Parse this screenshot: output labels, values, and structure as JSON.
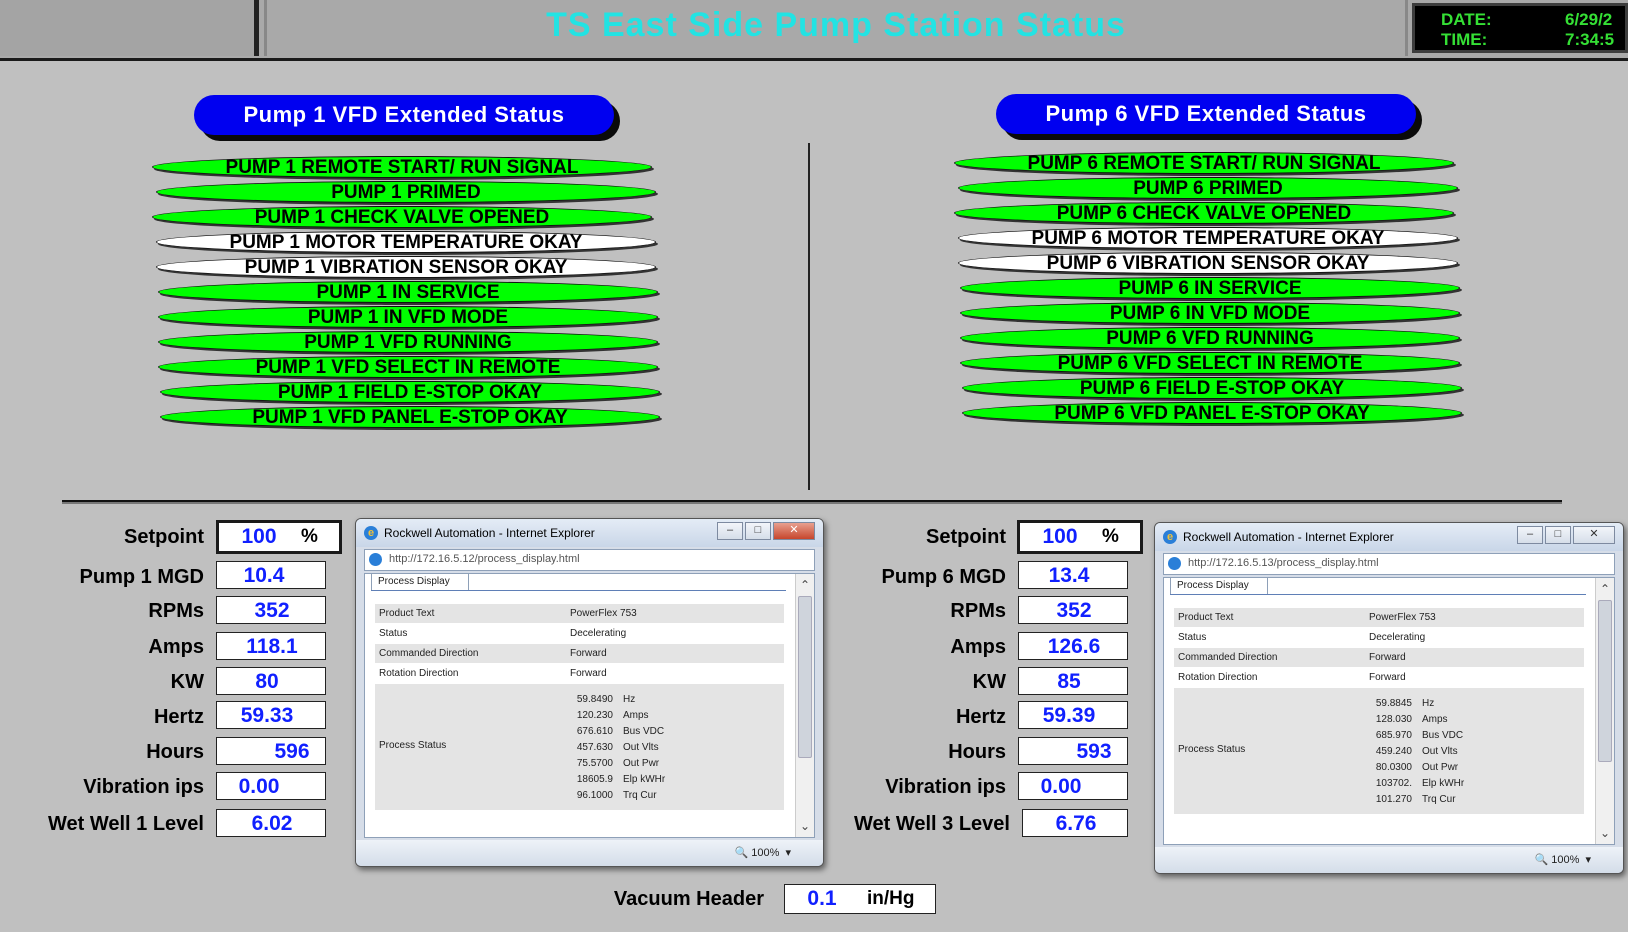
{
  "header": {
    "title": "TS East Side Pump Station Status",
    "date_label": "DATE:",
    "date_value": "6/29/2",
    "time_label": "TIME:",
    "time_value": "7:34:5"
  },
  "pump1": {
    "title": "Pump 1 VFD Extended Status",
    "statuses": [
      {
        "label": "PUMP 1 REMOTE START/ RUN SIGNAL",
        "color": "#00ff00"
      },
      {
        "label": "PUMP 1 PRIMED",
        "color": "#00ff00"
      },
      {
        "label": "PUMP 1 CHECK VALVE OPENED",
        "color": "#00ff00"
      },
      {
        "label": "PUMP 1 MOTOR TEMPERATURE OKAY",
        "color": "#ffffff"
      },
      {
        "label": "PUMP 1 VIBRATION SENSOR OKAY",
        "color": "#ffffff"
      },
      {
        "label": "PUMP 1 IN SERVICE",
        "color": "#00ff00"
      },
      {
        "label": "PUMP 1 IN VFD MODE",
        "color": "#00ff00"
      },
      {
        "label": "PUMP 1 VFD RUNNING",
        "color": "#00ff00"
      },
      {
        "label": "PUMP 1 VFD SELECT IN REMOTE",
        "color": "#00ff00"
      },
      {
        "label": "PUMP 1 FIELD E-STOP OKAY",
        "color": "#00ff00"
      },
      {
        "label": "PUMP 1 VFD PANEL E-STOP OKAY",
        "color": "#00ff00"
      }
    ],
    "fields": {
      "setpoint_label": "Setpoint",
      "setpoint": "100",
      "setpoint_unit": "%",
      "mgd_label": "Pump 1 MGD",
      "mgd": "10.4",
      "rpm_label": "RPMs",
      "rpm": "352",
      "amps_label": "Amps",
      "amps": "118.1",
      "kw_label": "KW",
      "kw": "80",
      "hertz_label": "Hertz",
      "hertz": "59.33",
      "hours_label": "Hours",
      "hours": "596",
      "vib_label": "Vibration ips",
      "vib": "0.00",
      "ww_label": "Wet Well 1 Level",
      "ww": "6.02"
    },
    "browser": {
      "title": "Rockwell Automation - Internet Explorer",
      "url": "http://172.16.5.12/process_display.html",
      "tab": "Process Display",
      "product_text_label": "Product Text",
      "product_text": "PowerFlex 753",
      "status_label": "Status",
      "status": "Decelerating",
      "cmd_dir_label": "Commanded Direction",
      "cmd_dir": "Forward",
      "rot_dir_label": "Rotation Direction",
      "rot_dir": "Forward",
      "process_status_label": "Process Status",
      "process": [
        {
          "value": "59.8490",
          "unit": "Hz"
        },
        {
          "value": "120.230",
          "unit": "Amps"
        },
        {
          "value": "676.610",
          "unit": "Bus VDC"
        },
        {
          "value": "457.630",
          "unit": "Out Vlts"
        },
        {
          "value": "75.5700",
          "unit": "Out Pwr"
        },
        {
          "value": "18605.9",
          "unit": "Elp kWHr"
        },
        {
          "value": "96.1000",
          "unit": "Trq Cur"
        }
      ],
      "zoom": "100%"
    }
  },
  "pump6": {
    "title": "Pump 6 VFD Extended Status",
    "statuses": [
      {
        "label": "PUMP 6 REMOTE START/ RUN SIGNAL",
        "color": "#00ff00"
      },
      {
        "label": "PUMP 6 PRIMED",
        "color": "#00ff00"
      },
      {
        "label": "PUMP 6 CHECK VALVE OPENED",
        "color": "#00ff00"
      },
      {
        "label": "PUMP 6 MOTOR TEMPERATURE OKAY",
        "color": "#ffffff"
      },
      {
        "label": "PUMP 6 VIBRATION SENSOR OKAY",
        "color": "#ffffff"
      },
      {
        "label": "PUMP 6 IN SERVICE",
        "color": "#00ff00"
      },
      {
        "label": "PUMP 6 IN VFD MODE",
        "color": "#00ff00"
      },
      {
        "label": "PUMP 6 VFD RUNNING",
        "color": "#00ff00"
      },
      {
        "label": "PUMP 6 VFD SELECT IN REMOTE",
        "color": "#00ff00"
      },
      {
        "label": "PUMP 6 FIELD E-STOP OKAY",
        "color": "#00ff00"
      },
      {
        "label": "PUMP 6 VFD PANEL E-STOP OKAY",
        "color": "#00ff00"
      }
    ],
    "fields": {
      "setpoint_label": "Setpoint",
      "setpoint": "100",
      "setpoint_unit": "%",
      "mgd_label": "Pump 6 MGD",
      "mgd": "13.4",
      "rpm_label": "RPMs",
      "rpm": "352",
      "amps_label": "Amps",
      "amps": "126.6",
      "kw_label": "KW",
      "kw": "85",
      "hertz_label": "Hertz",
      "hertz": "59.39",
      "hours_label": "Hours",
      "hours": "593",
      "vib_label": "Vibration ips",
      "vib": "0.00",
      "ww_label": "Wet Well 3 Level",
      "ww": "6.76"
    },
    "browser": {
      "title": "Rockwell Automation - Internet Explorer",
      "url": "http://172.16.5.13/process_display.html",
      "tab": "Process Display",
      "product_text_label": "Product Text",
      "product_text": "PowerFlex 753",
      "status_label": "Status",
      "status": "Decelerating",
      "cmd_dir_label": "Commanded Direction",
      "cmd_dir": "Forward",
      "rot_dir_label": "Rotation Direction",
      "rot_dir": "Forward",
      "process_status_label": "Process Status",
      "process": [
        {
          "value": "59.8845",
          "unit": "Hz"
        },
        {
          "value": "128.030",
          "unit": "Amps"
        },
        {
          "value": "685.970",
          "unit": "Bus VDC"
        },
        {
          "value": "459.240",
          "unit": "Out Vlts"
        },
        {
          "value": "80.0300",
          "unit": "Out Pwr"
        },
        {
          "value": "103702.",
          "unit": "Elp kWHr"
        },
        {
          "value": "101.270",
          "unit": "Trq Cur"
        }
      ],
      "zoom": "100%"
    }
  },
  "vacuum": {
    "label": "Vacuum Header",
    "value": "0.1",
    "unit": "in/Hg"
  }
}
